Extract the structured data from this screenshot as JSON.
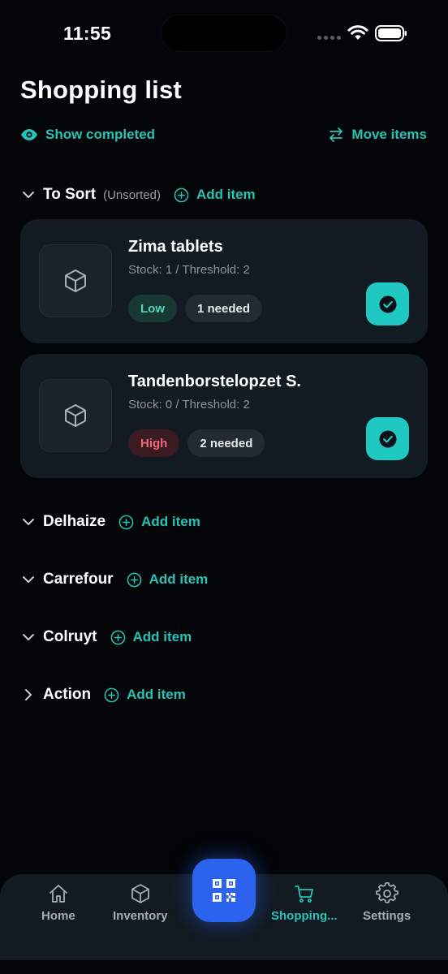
{
  "status_bar": {
    "time": "11:55"
  },
  "page": {
    "title": "Shopping list"
  },
  "actions": {
    "show_completed": "Show completed",
    "move_items": "Move items"
  },
  "sections": [
    {
      "title": "To Sort",
      "subtitle": "(Unsorted)",
      "add_label": "Add item",
      "expanded": true
    },
    {
      "title": "Delhaize",
      "add_label": "Add item",
      "expanded": true
    },
    {
      "title": "Carrefour",
      "add_label": "Add item",
      "expanded": true
    },
    {
      "title": "Colruyt",
      "add_label": "Add item",
      "expanded": true
    },
    {
      "title": "Action",
      "add_label": "Add item",
      "expanded": false
    }
  ],
  "items": [
    {
      "name": "Zima tablets",
      "stock": "Stock: 1 / Threshold: 2",
      "priority": "Low",
      "needed": "1 needed"
    },
    {
      "name": "Tandenborstelopzet S.",
      "stock": "Stock: 0 / Threshold: 2",
      "priority": "High",
      "needed": "2 needed"
    }
  ],
  "nav": {
    "home": "Home",
    "inventory": "Inventory",
    "shopping": "Shopping...",
    "settings": "Settings",
    "active": "shopping"
  },
  "colors": {
    "accent": "#26c3b6",
    "scan_button": "#2b63ef",
    "card_bg": "#121a22",
    "low": "#52d3c0",
    "high": "#f0687a"
  }
}
